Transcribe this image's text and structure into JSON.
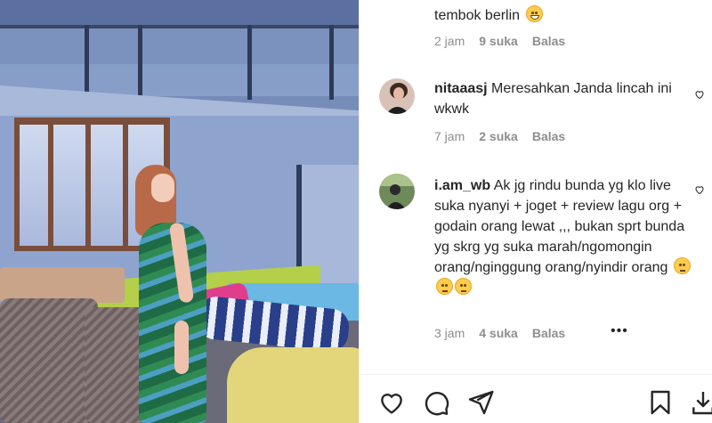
{
  "comments": [
    {
      "username": "",
      "text_line": "tembok berlin",
      "time": "2 jam",
      "likes": "9 suka",
      "reply": "Balas"
    },
    {
      "username": "nitaaasj",
      "text": "Meresahkan Janda lincah ini wkwk",
      "time": "7 jam",
      "likes": "2 suka",
      "reply": "Balas"
    },
    {
      "username": "i.am_wb",
      "text": "Ak jg rindu bunda yg klo live suka nyanyi + joget + review lagu org + godain orang lewat ,,, bukan sprt bunda yg skrg yg suka marah/ngomongin orang/nginggung orang/nyindir orang",
      "time": "3 jam",
      "likes": "4 suka",
      "reply": "Balas",
      "more": "•••"
    }
  ],
  "icons": {
    "like": "heart-icon",
    "comment": "comment-icon",
    "share": "paper-plane-icon",
    "save": "bookmark-icon",
    "download": "download-icon"
  }
}
